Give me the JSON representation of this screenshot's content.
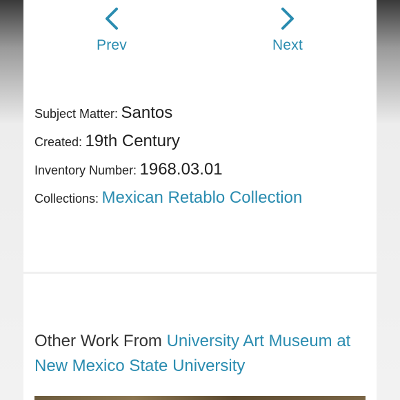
{
  "nav": {
    "prev_label": "Prev",
    "next_label": "Next",
    "prev_icon": "chevron-left-icon",
    "next_icon": "chevron-right-icon"
  },
  "details": {
    "subject_label": "Subject Matter:",
    "subject_value": "Santos",
    "created_label": "Created:",
    "created_value": "19th Century",
    "inventory_label": "Inventory Number:",
    "inventory_value": "1968.03.01",
    "collections_label": "Collections:",
    "collections_value": "Mexican Retablo Collection"
  },
  "other_work": {
    "prefix": "Other Work From",
    "museum_link": "University Art Museum at New Mexico State University"
  },
  "colors": {
    "link": "#2a8cb0",
    "text": "#222222",
    "card": "#ffffff"
  }
}
